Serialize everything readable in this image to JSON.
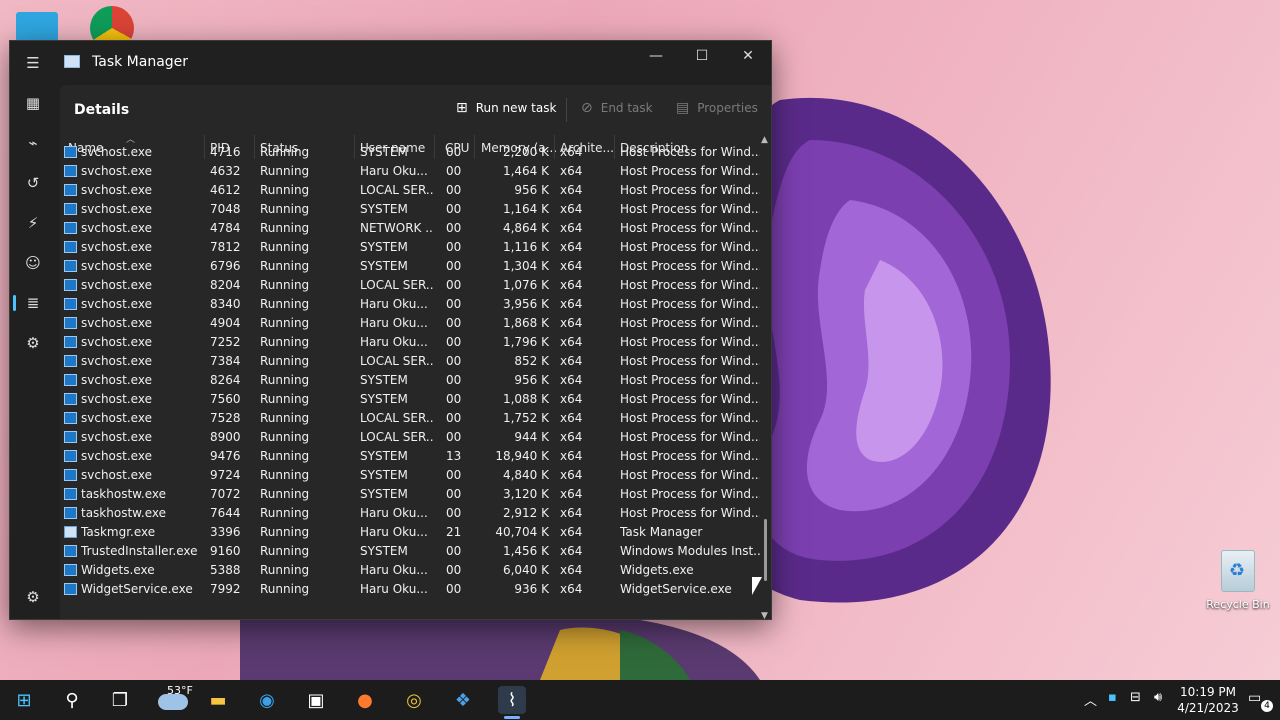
{
  "window": {
    "title": "Task Manager",
    "minimize_icon": "minimize-icon",
    "maximize_icon": "maximize-icon",
    "close_icon": "close-icon"
  },
  "nav": [
    "hamburger-icon",
    "processes-icon",
    "performance-icon",
    "app-history-icon",
    "startup-apps-icon",
    "users-icon",
    "details-icon",
    "services-icon",
    "settings-icon"
  ],
  "toolbar": {
    "title": "Details",
    "run_new_task": "Run new task",
    "end_task": "End task",
    "properties": "Properties"
  },
  "columns": {
    "name": "Name",
    "pid": "PID",
    "status": "Status",
    "user": "User name",
    "cpu": "CPU",
    "memory": "Memory (a...",
    "arch": "Archite...",
    "desc": "Description"
  },
  "rows": [
    {
      "name": "svchost.exe",
      "pid": "4716",
      "status": "Running",
      "user": "SYSTEM",
      "cpu": "00",
      "mem": "2,200 K",
      "arch": "x64",
      "desc": "Host Process for Wind..."
    },
    {
      "name": "svchost.exe",
      "pid": "4632",
      "status": "Running",
      "user": "Haru Oku...",
      "cpu": "00",
      "mem": "1,464 K",
      "arch": "x64",
      "desc": "Host Process for Wind..."
    },
    {
      "name": "svchost.exe",
      "pid": "4612",
      "status": "Running",
      "user": "LOCAL SER...",
      "cpu": "00",
      "mem": "956 K",
      "arch": "x64",
      "desc": "Host Process for Wind..."
    },
    {
      "name": "svchost.exe",
      "pid": "7048",
      "status": "Running",
      "user": "SYSTEM",
      "cpu": "00",
      "mem": "1,164 K",
      "arch": "x64",
      "desc": "Host Process for Wind..."
    },
    {
      "name": "svchost.exe",
      "pid": "4784",
      "status": "Running",
      "user": "NETWORK ...",
      "cpu": "00",
      "mem": "4,864 K",
      "arch": "x64",
      "desc": "Host Process for Wind..."
    },
    {
      "name": "svchost.exe",
      "pid": "7812",
      "status": "Running",
      "user": "SYSTEM",
      "cpu": "00",
      "mem": "1,116 K",
      "arch": "x64",
      "desc": "Host Process for Wind..."
    },
    {
      "name": "svchost.exe",
      "pid": "6796",
      "status": "Running",
      "user": "SYSTEM",
      "cpu": "00",
      "mem": "1,304 K",
      "arch": "x64",
      "desc": "Host Process for Wind..."
    },
    {
      "name": "svchost.exe",
      "pid": "8204",
      "status": "Running",
      "user": "LOCAL SER...",
      "cpu": "00",
      "mem": "1,076 K",
      "arch": "x64",
      "desc": "Host Process for Wind..."
    },
    {
      "name": "svchost.exe",
      "pid": "8340",
      "status": "Running",
      "user": "Haru Oku...",
      "cpu": "00",
      "mem": "3,956 K",
      "arch": "x64",
      "desc": "Host Process for Wind..."
    },
    {
      "name": "svchost.exe",
      "pid": "4904",
      "status": "Running",
      "user": "Haru Oku...",
      "cpu": "00",
      "mem": "1,868 K",
      "arch": "x64",
      "desc": "Host Process for Wind..."
    },
    {
      "name": "svchost.exe",
      "pid": "7252",
      "status": "Running",
      "user": "Haru Oku...",
      "cpu": "00",
      "mem": "1,796 K",
      "arch": "x64",
      "desc": "Host Process for Wind..."
    },
    {
      "name": "svchost.exe",
      "pid": "7384",
      "status": "Running",
      "user": "LOCAL SER...",
      "cpu": "00",
      "mem": "852 K",
      "arch": "x64",
      "desc": "Host Process for Wind..."
    },
    {
      "name": "svchost.exe",
      "pid": "8264",
      "status": "Running",
      "user": "SYSTEM",
      "cpu": "00",
      "mem": "956 K",
      "arch": "x64",
      "desc": "Host Process for Wind..."
    },
    {
      "name": "svchost.exe",
      "pid": "7560",
      "status": "Running",
      "user": "SYSTEM",
      "cpu": "00",
      "mem": "1,088 K",
      "arch": "x64",
      "desc": "Host Process for Wind..."
    },
    {
      "name": "svchost.exe",
      "pid": "7528",
      "status": "Running",
      "user": "LOCAL SER...",
      "cpu": "00",
      "mem": "1,752 K",
      "arch": "x64",
      "desc": "Host Process for Wind..."
    },
    {
      "name": "svchost.exe",
      "pid": "8900",
      "status": "Running",
      "user": "LOCAL SER...",
      "cpu": "00",
      "mem": "944 K",
      "arch": "x64",
      "desc": "Host Process for Wind..."
    },
    {
      "name": "svchost.exe",
      "pid": "9476",
      "status": "Running",
      "user": "SYSTEM",
      "cpu": "13",
      "mem": "18,940 K",
      "arch": "x64",
      "desc": "Host Process for Wind..."
    },
    {
      "name": "svchost.exe",
      "pid": "9724",
      "status": "Running",
      "user": "SYSTEM",
      "cpu": "00",
      "mem": "4,840 K",
      "arch": "x64",
      "desc": "Host Process for Wind..."
    },
    {
      "name": "taskhostw.exe",
      "pid": "7072",
      "status": "Running",
      "user": "SYSTEM",
      "cpu": "00",
      "mem": "3,120 K",
      "arch": "x64",
      "desc": "Host Process for Wind..."
    },
    {
      "name": "taskhostw.exe",
      "pid": "7644",
      "status": "Running",
      "user": "Haru Oku...",
      "cpu": "00",
      "mem": "2,912 K",
      "arch": "x64",
      "desc": "Host Process for Wind..."
    },
    {
      "name": "Taskmgr.exe",
      "pid": "3396",
      "status": "Running",
      "user": "Haru Oku...",
      "cpu": "21",
      "mem": "40,704 K",
      "arch": "x64",
      "desc": "Task Manager"
    },
    {
      "name": "TrustedInstaller.exe",
      "pid": "9160",
      "status": "Running",
      "user": "SYSTEM",
      "cpu": "00",
      "mem": "1,456 K",
      "arch": "x64",
      "desc": "Windows Modules Inst..."
    },
    {
      "name": "Widgets.exe",
      "pid": "5388",
      "status": "Running",
      "user": "Haru Oku...",
      "cpu": "00",
      "mem": "6,040 K",
      "arch": "x64",
      "desc": "Widgets.exe"
    },
    {
      "name": "WidgetService.exe",
      "pid": "7992",
      "status": "Running",
      "user": "Haru Oku...",
      "cpu": "00",
      "mem": "936 K",
      "arch": "x64",
      "desc": "WidgetService.exe"
    }
  ],
  "desktop": {
    "recycle_bin": "Recycle Bin"
  },
  "taskbar": {
    "weather_temp": "53°F",
    "time": "10:19 PM",
    "date": "4/21/2023",
    "notification_count": "4"
  },
  "colors": {
    "window_bg": "#202020",
    "panel_bg": "#272727",
    "accent": "#4cc2ff"
  }
}
